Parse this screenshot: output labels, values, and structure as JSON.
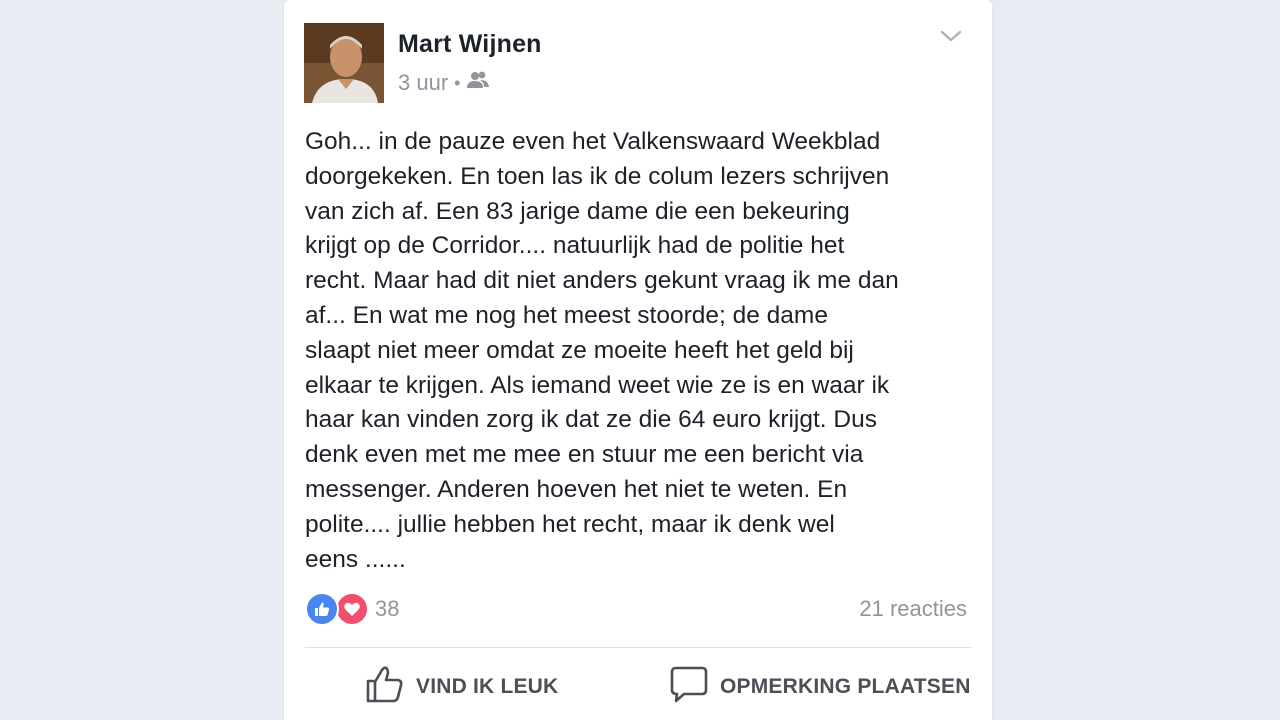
{
  "post": {
    "author": "Mart Wijnen",
    "time": "3 uur",
    "separator": "•",
    "audience_icon": "friends-icon",
    "text": "Goh... in de pauze even het Valkenswaard Weekblad\ndoorgekeken. En toen las ik de colum lezers schrijven\nvan zich af. Een 83 jarige dame die een bekeuring\nkrijgt op de Corridor.... natuurlijk had de politie het\nrecht. Maar had dit niet anders gekunt vraag ik me dan\naf... En wat me nog het meest stoorde; de dame\nslaapt niet meer omdat ze moeite heeft het geld bij\nelkaar te krijgen. Als iemand weet wie ze is en waar ik\nhaar kan vinden zorg ik dat ze die 64 euro krijgt. Dus\ndenk even met me mee en stuur me een bericht via\nmessenger. Anderen hoeven het niet te weten. En\npolite.... jullie hebben het recht, maar ik denk wel\neens ......",
    "reaction_count": "38",
    "comments_label": "21 reacties"
  },
  "actions": {
    "like_label": "VIND IK LEUK",
    "comment_label": "OPMERKING PLAATSEN"
  },
  "colors": {
    "like_blue": "#4a86f0",
    "love_red": "#f0506e",
    "text_dark": "#1d2129",
    "text_grey": "#90949c"
  }
}
